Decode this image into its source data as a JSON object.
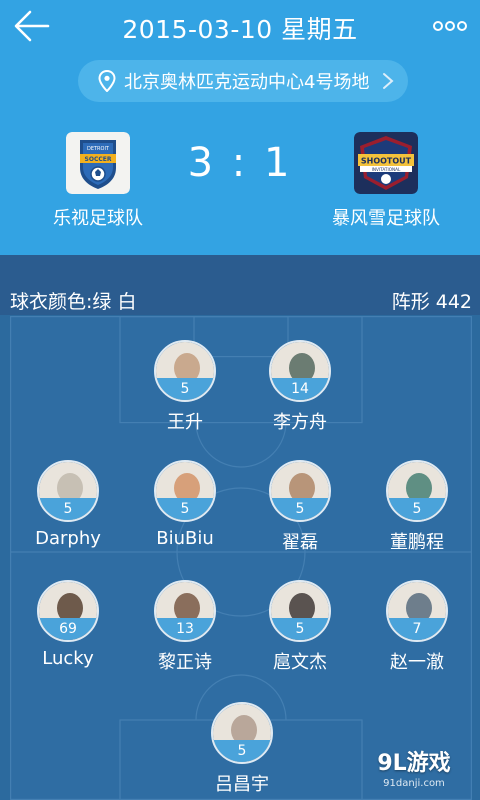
{
  "header": {
    "title": "2015-03-10  星期五",
    "venue": "北京奥林匹克运动中心4号场地"
  },
  "match": {
    "score": "3 : 1",
    "home_team": {
      "name": "乐视足球队",
      "logo_lines": [
        "DETROIT",
        "SOCCER"
      ]
    },
    "away_team": {
      "name": "暴风雪足球队",
      "logo_lines": [
        "SHOOTOUT",
        "INVITATIONAL"
      ]
    }
  },
  "lineup": {
    "jersey_label": "球衣颜色:绿 白",
    "formation_label": "阵形 442",
    "players": [
      {
        "name": "王升",
        "number": "5",
        "color": "#c9a98e"
      },
      {
        "name": "李方舟",
        "number": "14",
        "color": "#6b7c72"
      },
      {
        "name": "Darphy",
        "number": "5",
        "color": "#c7c0b4"
      },
      {
        "name": "BiuBiu",
        "number": "5",
        "color": "#d7a07a"
      },
      {
        "name": "翟磊",
        "number": "5",
        "color": "#b89579"
      },
      {
        "name": "董鹏程",
        "number": "5",
        "color": "#5f8f83"
      },
      {
        "name": "Lucky",
        "number": "69",
        "color": "#6e5a4b"
      },
      {
        "name": "黎正诗",
        "number": "13",
        "color": "#8a6e5c"
      },
      {
        "name": "扈文杰",
        "number": "5",
        "color": "#5a5350"
      },
      {
        "name": "赵一澈",
        "number": "7",
        "color": "#6e7e8c"
      },
      {
        "name": "吕昌宇",
        "number": "5",
        "color": "#b9a79a"
      }
    ]
  },
  "watermark": {
    "logo": "9L游戏",
    "url": "91danji.com"
  },
  "colors": {
    "header_bg": "#33a3e3",
    "pitch_bg": "#2f6da3",
    "number_band": "#4aa3da"
  },
  "icons": {
    "back": "back-arrow-icon",
    "more": "more-dots-icon",
    "venue": "location-pin-icon",
    "venue_chevron": "chevron-right-icon"
  }
}
